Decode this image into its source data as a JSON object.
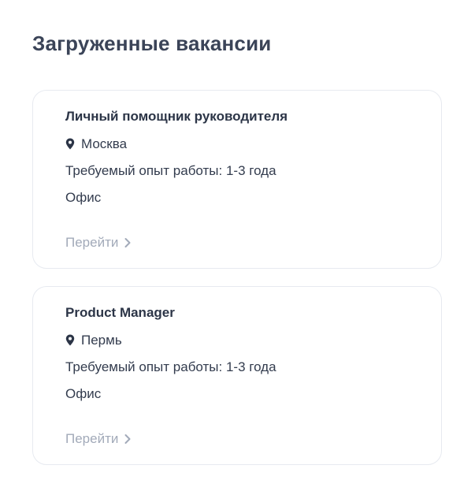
{
  "page": {
    "title": "Загруженные вакансии"
  },
  "vacancies": [
    {
      "title": "Личный помощник руководителя",
      "location": "Москва",
      "experience": "Требуемый опыт работы: 1-3 года",
      "format": "Офис",
      "link_label": "Перейти"
    },
    {
      "title": "Product Manager",
      "location": "Пермь",
      "experience": "Требуемый опыт работы: 1-3 года",
      "format": "Офис",
      "link_label": "Перейти"
    }
  ],
  "icons": {
    "location": "map-pin-icon",
    "link_arrow": "chevron-right-icon"
  },
  "colors": {
    "title": "#3b4458",
    "text": "#333c4e",
    "link": "#a2aab9",
    "card_border": "#e7eaf0"
  }
}
